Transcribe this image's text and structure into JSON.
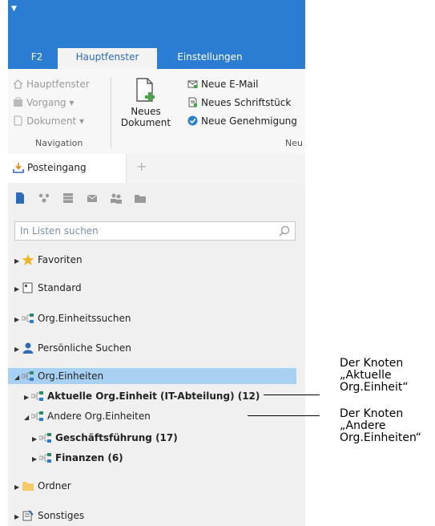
{
  "tabs": [
    {
      "label": "F2"
    },
    {
      "label": "Hauptfenster",
      "active": true
    },
    {
      "label": "Einstellungen"
    }
  ],
  "ribbon": {
    "navigation": {
      "items": [
        "Hauptfenster",
        "Vorgang ▾",
        "Dokument ▾"
      ],
      "group_label": "Navigation"
    },
    "neues_dokument": {
      "line1": "Neues",
      "line2": "Dokument"
    },
    "neu": {
      "items": [
        "Neue E-Mail",
        "Neues Schriftstück",
        "Neue Genehmigung"
      ],
      "group_label": "Neu"
    }
  },
  "document_tab": {
    "label": "Posteingang"
  },
  "search": {
    "placeholder": "In Listen suchen"
  },
  "tree": {
    "favoriten": "Favoriten",
    "standard": "Standard",
    "org_suchen": "Org.Einheitssuchen",
    "persoenliche": "Persönliche Suchen",
    "org_einheiten": "Org.Einheiten",
    "aktuelle": "Aktuelle Org.Einheit (IT-Abteilung) (12)",
    "andere": "Andere Org.Einheiten",
    "geschaeftsfuehrung": "Geschäftsführung (17)",
    "finanzen": "Finanzen (6)",
    "ordner": "Ordner",
    "sonstiges": "Sonstiges"
  },
  "annotations": {
    "aktuelle": [
      "Der Knoten",
      "„Aktuelle",
      "Org.Einheit“"
    ],
    "andere": [
      "Der Knoten",
      "„Andere",
      "Org.Einheiten“"
    ]
  },
  "colors": {
    "titlebar": "#2b7cd3",
    "selection": "#a7d0f3",
    "accent": "#2b6cb8"
  }
}
